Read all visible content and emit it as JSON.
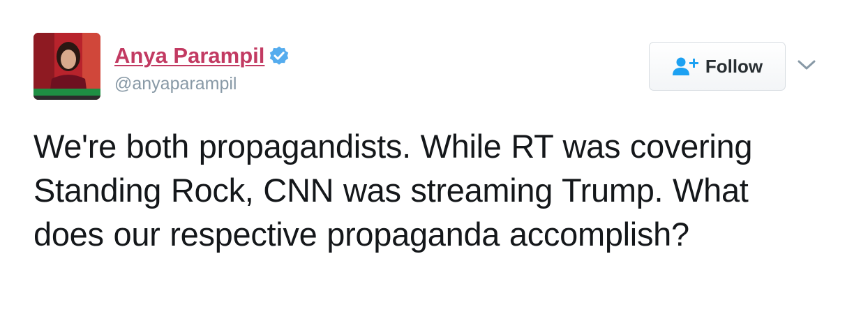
{
  "tweet": {
    "author": {
      "display_name": "Anya Parampil",
      "handle": "@anyaparampil",
      "verified": true,
      "avatar": "profile-photo"
    },
    "follow_button": {
      "label": "Follow",
      "icon": "follow-user-plus-icon"
    },
    "menu_icon": "chevron-down-icon",
    "text": "We're both propagandists. While RT was covering Standing Rock, CNN was streaming Trump. What does our respective propaganda accomplish?"
  },
  "colors": {
    "name": "#c23a62",
    "handle": "#8899a6",
    "verified_badge": "#55acee",
    "follow_icon": "#1da1f2",
    "text": "#14171a"
  }
}
